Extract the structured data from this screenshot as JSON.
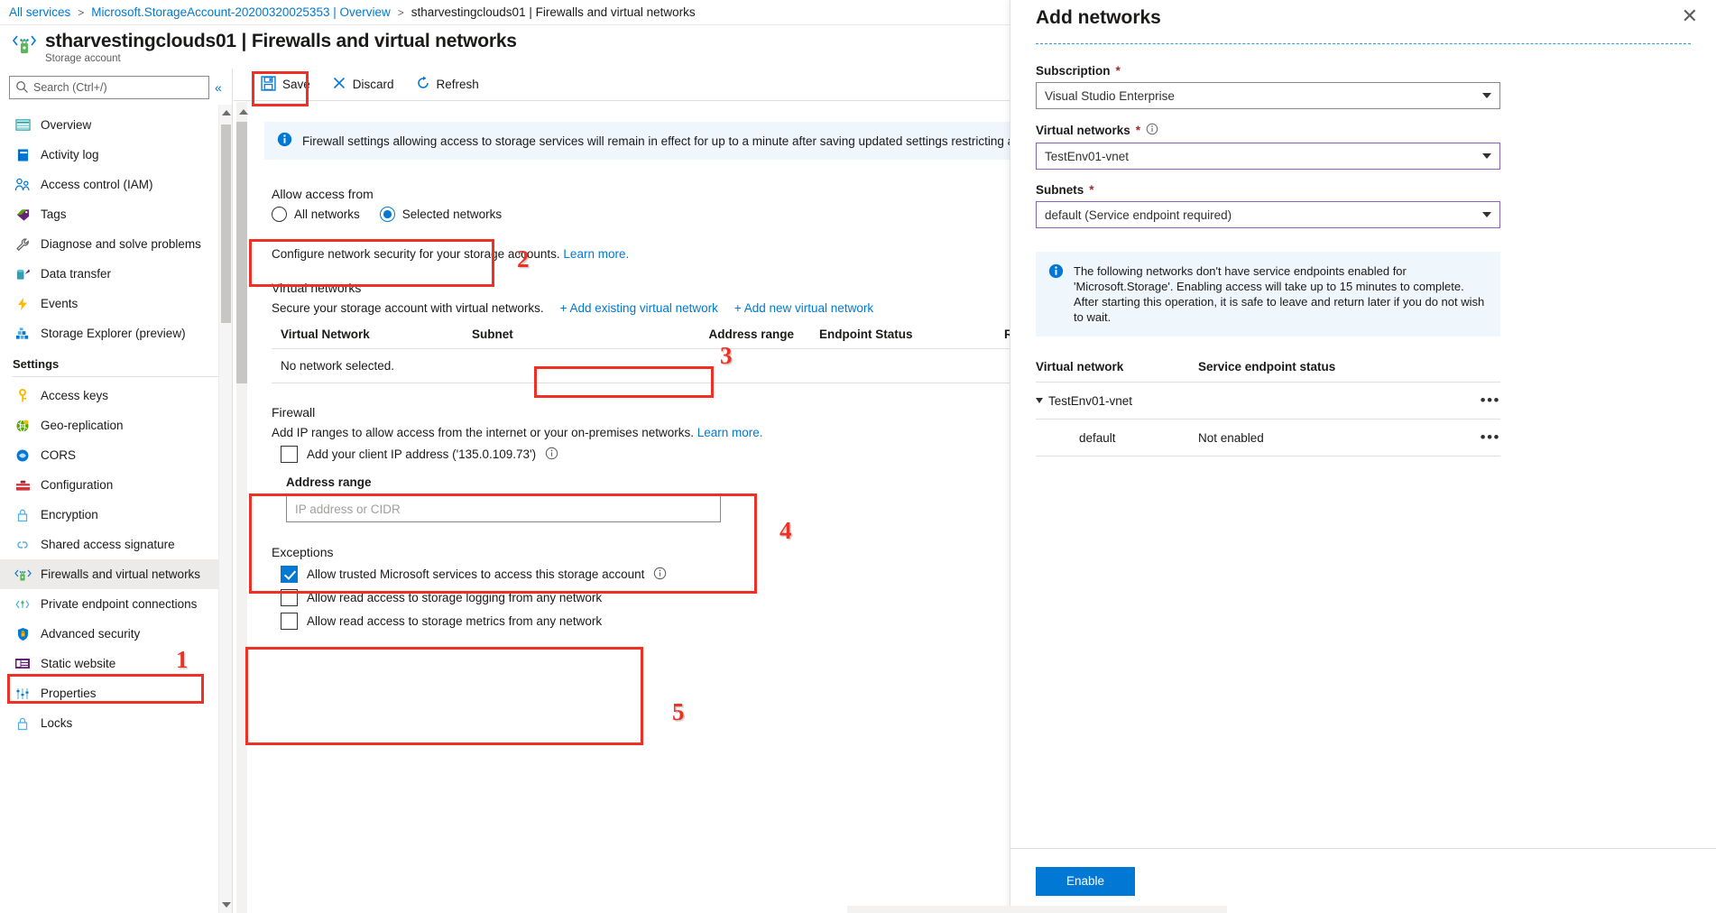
{
  "breadcrumb": {
    "items": [
      {
        "label": "All services",
        "link": true
      },
      {
        "label": "Microsoft.StorageAccount-20200320025353 | Overview",
        "link": true
      },
      {
        "label": "stharvestingclouds01 | Firewalls and virtual networks",
        "link": false
      }
    ],
    "separator": ">"
  },
  "header": {
    "title": "stharvestingclouds01 | Firewalls and virtual networks",
    "subtitle": "Storage account"
  },
  "search": {
    "placeholder": "Search (Ctrl+/)",
    "value": "",
    "collapse_label": "«"
  },
  "sidebar": {
    "items": [
      {
        "label": "Overview",
        "icon": "overview-icon"
      },
      {
        "label": "Activity log",
        "icon": "activity-log-icon"
      },
      {
        "label": "Access control (IAM)",
        "icon": "access-control-icon"
      },
      {
        "label": "Tags",
        "icon": "tags-icon"
      },
      {
        "label": "Diagnose and solve problems",
        "icon": "wrench-icon"
      },
      {
        "label": "Data transfer",
        "icon": "data-transfer-icon"
      },
      {
        "label": "Events",
        "icon": "events-icon"
      },
      {
        "label": "Storage Explorer (preview)",
        "icon": "storage-explorer-icon"
      }
    ],
    "settings_label": "Settings",
    "settings_items": [
      {
        "label": "Access keys",
        "icon": "key-icon"
      },
      {
        "label": "Geo-replication",
        "icon": "globe-icon"
      },
      {
        "label": "CORS",
        "icon": "cors-icon"
      },
      {
        "label": "Configuration",
        "icon": "toolbox-icon"
      },
      {
        "label": "Encryption",
        "icon": "lock-icon"
      },
      {
        "label": "Shared access signature",
        "icon": "link-icon"
      },
      {
        "label": "Firewalls and virtual networks",
        "icon": "firewall-icon",
        "selected": true
      },
      {
        "label": "Private endpoint connections",
        "icon": "private-endpoint-icon"
      },
      {
        "label": "Advanced security",
        "icon": "shield-icon"
      },
      {
        "label": "Static website",
        "icon": "static-website-icon"
      },
      {
        "label": "Properties",
        "icon": "properties-icon"
      },
      {
        "label": "Locks",
        "icon": "lock-icon"
      }
    ]
  },
  "toolbar": {
    "save_label": "Save",
    "discard_label": "Discard",
    "refresh_label": "Refresh"
  },
  "main": {
    "info_banner": "Firewall settings allowing access to storage services will remain in effect for up to a minute after saving updated settings restricting access.",
    "allow_access": {
      "legend": "Allow access from",
      "options": [
        {
          "label": "All networks",
          "selected": false
        },
        {
          "label": "Selected networks",
          "selected": true
        }
      ]
    },
    "configure_text": "Configure network security for your storage accounts.",
    "configure_link": "Learn more.",
    "virtual_networks": {
      "title": "Virtual networks",
      "secure_text": "Secure your storage account with virtual networks.",
      "add_existing_label": "+ Add existing virtual network",
      "add_new_label": "+ Add new virtual network",
      "columns": [
        "Virtual Network",
        "Subnet",
        "Address range",
        "Endpoint Status",
        "R"
      ],
      "empty_text": "No network selected."
    },
    "firewall": {
      "title": "Firewall",
      "description": "Add IP ranges to allow access from the internet or your on-premises networks.",
      "description_link": "Learn more.",
      "client_ip_label": "Add your client IP address ('135.0.109.73')",
      "client_ip_checked": false,
      "address_range_label": "Address range",
      "address_range_placeholder": "IP address or CIDR",
      "address_range_value": ""
    },
    "exceptions": {
      "title": "Exceptions",
      "items": [
        {
          "label": "Allow trusted Microsoft services to access this storage account",
          "checked": true,
          "info": true
        },
        {
          "label": "Allow read access to storage logging from any network",
          "checked": false,
          "info": false
        },
        {
          "label": "Allow read access to storage metrics from any network",
          "checked": false,
          "info": false
        }
      ]
    }
  },
  "annotations": {
    "numbers": [
      "1",
      "2",
      "3",
      "4",
      "5"
    ],
    "color": "#ee3124"
  },
  "blade": {
    "title": "Add networks",
    "close_label": "✕",
    "subscription": {
      "label": "Subscription",
      "required": "*",
      "value": "Visual Studio Enterprise"
    },
    "virtual_networks": {
      "label": "Virtual networks",
      "required": "*",
      "value": "TestEnv01-vnet"
    },
    "subnets": {
      "label": "Subnets",
      "required": "*",
      "value": "default (Service endpoint required)"
    },
    "info": "The following networks don't have service endpoints enabled for 'Microsoft.Storage'. Enabling access will take up to 15 minutes to complete. After starting this operation, it is safe to leave and return later if you do not wish to wait.",
    "table": {
      "columns": [
        "Virtual network",
        "Service endpoint status"
      ],
      "rows": [
        {
          "name": "TestEnv01-vnet",
          "status": "",
          "expandable": true,
          "indent": false
        },
        {
          "name": "default",
          "status": "Not enabled",
          "expandable": false,
          "indent": true
        }
      ],
      "menu_glyph": "•••"
    },
    "enable_label": "Enable"
  }
}
